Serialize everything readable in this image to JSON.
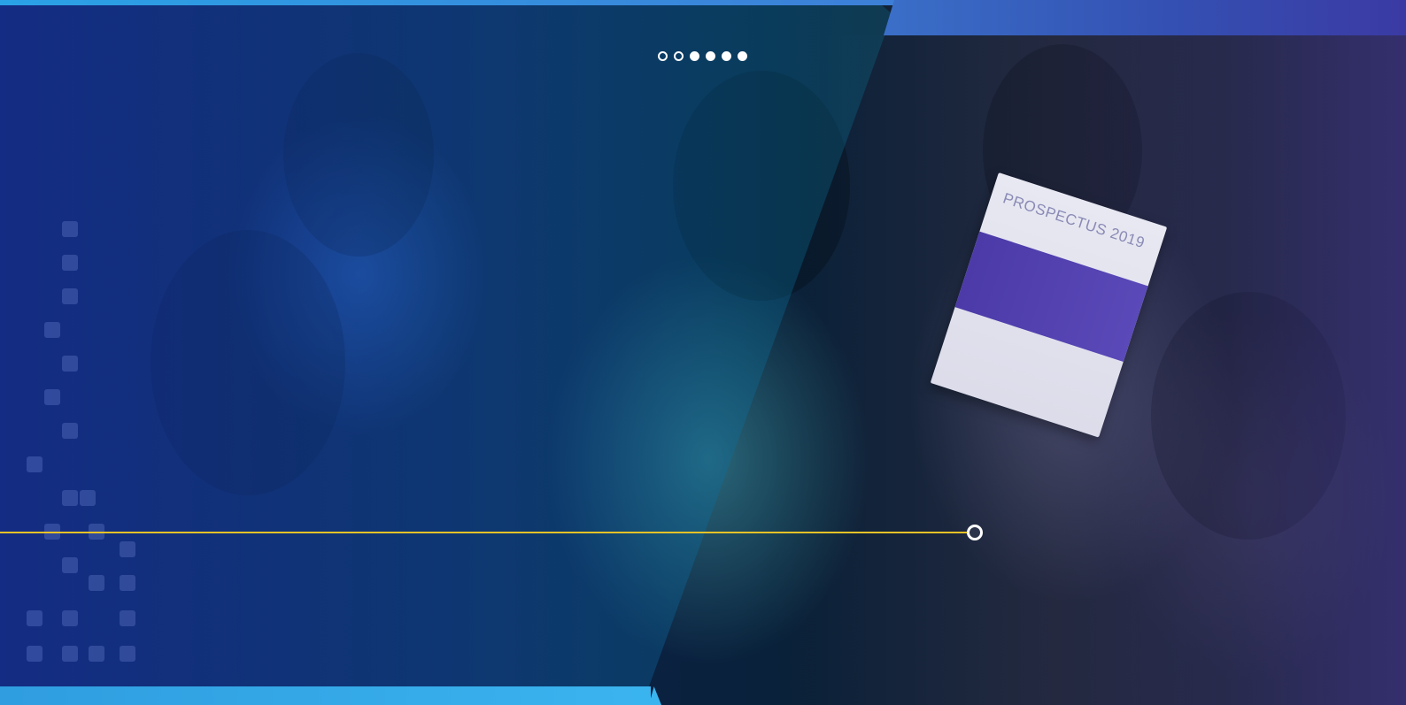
{
  "hero": {
    "colors": {
      "accent_blue": "#2aa2e6",
      "bar_blue": "#3450b2",
      "timeline_yellow": "#e8c227",
      "indicator_white": "#ffffff"
    },
    "slides": {
      "total": 6,
      "indicator_states": [
        "outline",
        "outline",
        "filled",
        "filled",
        "filled",
        "filled"
      ]
    },
    "booklet_text": "PROSPECTUS 2019"
  }
}
